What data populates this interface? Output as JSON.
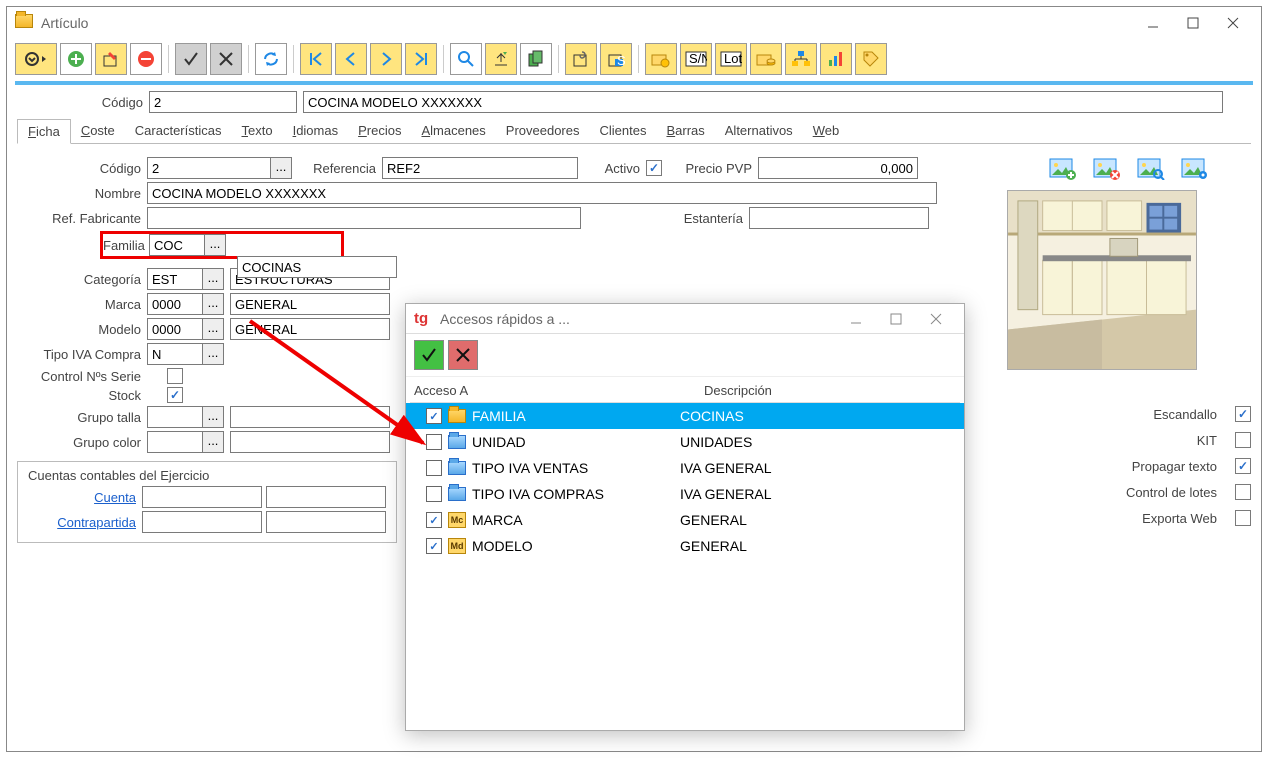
{
  "window": {
    "title": "Artículo"
  },
  "header": {
    "codigo_label": "Código",
    "codigo_value": "2",
    "desc_value": "COCINA MODELO XXXXXXX"
  },
  "tabs": [
    "Ficha",
    "Coste",
    "Características",
    "Texto",
    "Idiomas",
    "Precios",
    "Almacenes",
    "Proveedores",
    "Clientes",
    "Barras",
    "Alternativos",
    "Web"
  ],
  "ficha": {
    "codigo_label": "Código",
    "codigo": "2",
    "referencia_label": "Referencia",
    "referencia": "REF2",
    "activo_label": "Activo",
    "pvp_label": "Precio PVP",
    "pvp": "0,000",
    "nombre_label": "Nombre",
    "nombre": "COCINA MODELO XXXXXXX",
    "ref_fab_label": "Ref. Fabricante",
    "ref_fab": "",
    "estanteria_label": "Estantería",
    "estanteria": "",
    "familia_label": "Familia",
    "familia": "COC",
    "familia_desc": "COCINAS",
    "categoria_label": "Categoría",
    "categoria": "EST",
    "categoria_desc": "ESTRUCTURAS",
    "marca_label": "Marca",
    "marca": "0000",
    "marca_desc": "GENERAL",
    "modelo_label": "Modelo",
    "modelo": "0000",
    "modelo_desc": "GENERAL",
    "tipo_iva_label": "Tipo IVA Compra",
    "tipo_iva": "N",
    "control_serie_label": "Control Nºs Serie",
    "stock_label": "Stock",
    "grupo_talla_label": "Grupo talla",
    "grupo_color_label": "Grupo color",
    "cuentas_title": "Cuentas contables del Ejercicio",
    "cuenta_label": "Cuenta",
    "contrapartida_label": "Contrapartida",
    "escandallo": "Escandallo",
    "kit": "KIT",
    "propagar": "Propagar texto",
    "lotes": "Control de lotes",
    "exporta": "Exporta Web"
  },
  "dialog": {
    "title": "Accesos rápidos a ...",
    "col1": "Acceso A",
    "col2": "Descripción",
    "rows": [
      {
        "checked": true,
        "icon": "folder",
        "label": "FAMILIA",
        "desc": "COCINAS",
        "selected": true
      },
      {
        "checked": false,
        "icon": "bfolder",
        "label": "UNIDAD",
        "desc": "UNIDADES"
      },
      {
        "checked": false,
        "icon": "bfolder",
        "label": "TIPO IVA VENTAS",
        "desc": "IVA GENERAL"
      },
      {
        "checked": false,
        "icon": "bfolder",
        "label": "TIPO IVA COMPRAS",
        "desc": "IVA GENERAL"
      },
      {
        "checked": true,
        "icon": "mc",
        "mc": "Mc",
        "label": "MARCA",
        "desc": "GENERAL"
      },
      {
        "checked": true,
        "icon": "mc",
        "mc": "Md",
        "label": "MODELO",
        "desc": "GENERAL"
      }
    ]
  },
  "ellipsis": "..."
}
